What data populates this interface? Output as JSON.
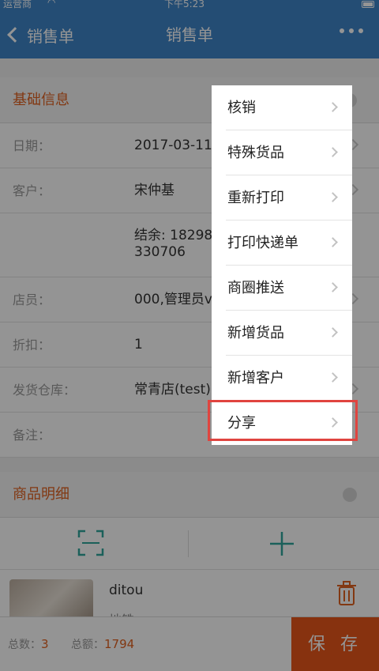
{
  "status_bar": {
    "carrier": "运营商",
    "time": "下午5:23"
  },
  "nav": {
    "back_label": "销售单",
    "title": "销售单"
  },
  "basic_info": {
    "title": "基础信息",
    "rows": [
      {
        "label": "日期：",
        "value": "2017-03-11"
      },
      {
        "label": "客户：",
        "value": "宋仲基"
      },
      {
        "label": "",
        "value": "结余: 18298330706"
      },
      {
        "label": "店员：",
        "value": "000,管理员v"
      },
      {
        "label": "折扣：",
        "value": "1"
      },
      {
        "label": "发货仓库：",
        "value": "常青店(test)"
      },
      {
        "label": "备注：",
        "value": ""
      }
    ]
  },
  "product_detail": {
    "title": "商品明细",
    "items": [
      {
        "name": "ditou",
        "subtitle": "地铁"
      }
    ]
  },
  "footer": {
    "count_label": "总数：",
    "count": "3",
    "amount_label": "总额：",
    "amount": "1794",
    "save_label": "保 存"
  },
  "menu": {
    "items": [
      "核销",
      "特殊货品",
      "重新打印",
      "打印快递单",
      "商圈推送",
      "新增货品",
      "新增客户",
      "分享"
    ],
    "highlighted": "分享"
  },
  "colors": {
    "nav": "#3f86c9",
    "accent": "#e0611f",
    "save": "#e8571b",
    "highlight_border": "#e0443f"
  }
}
